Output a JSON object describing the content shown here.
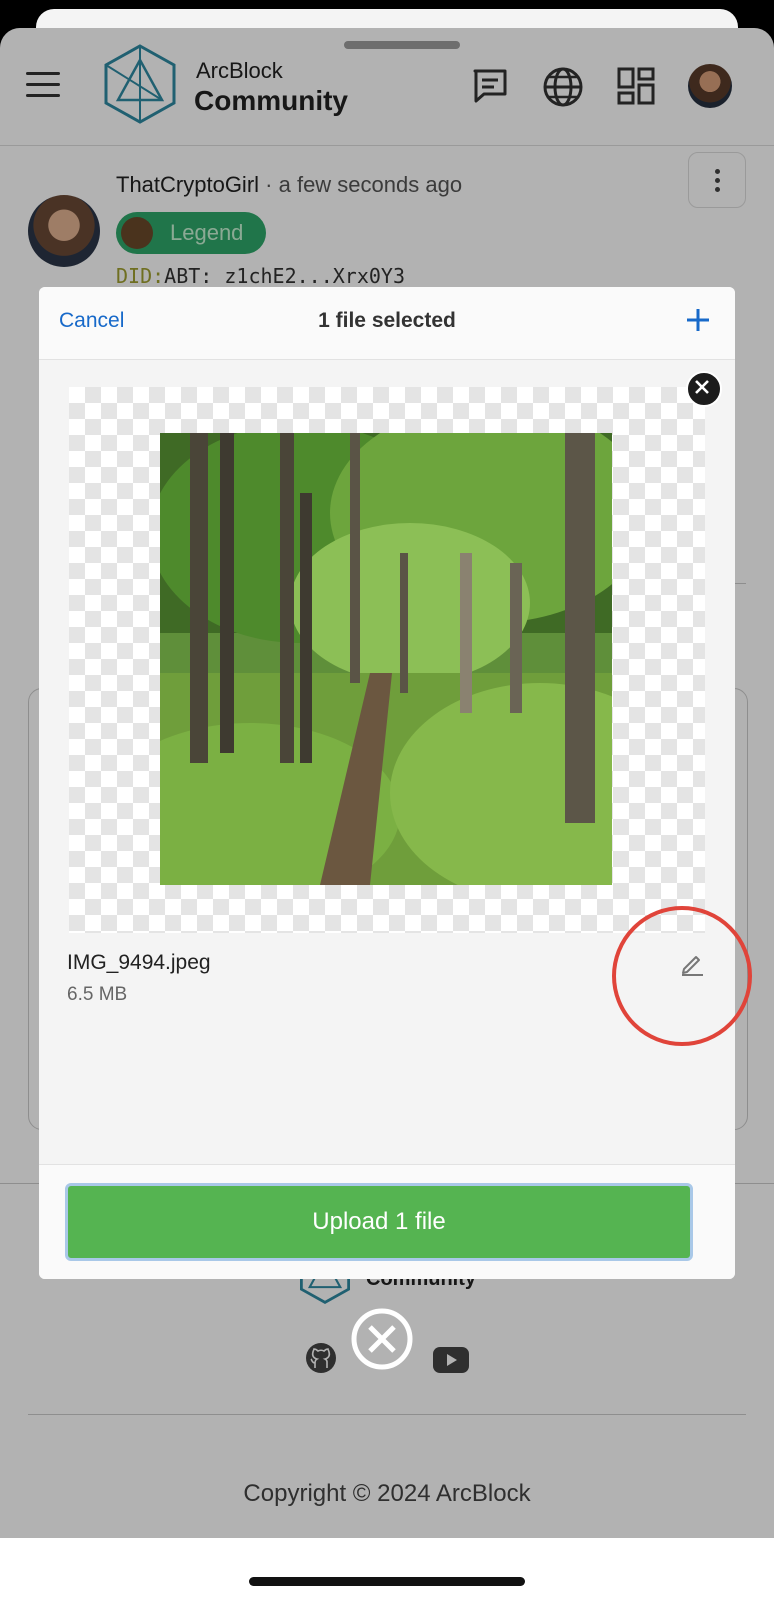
{
  "app": {
    "brand_top": "ArcBlock",
    "brand_bottom": "Community"
  },
  "post": {
    "author": "ThatCryptoGirl",
    "separator": " · ",
    "time": "a few seconds ago",
    "badge": "Legend",
    "did_prefix": "DID:",
    "did_value": "ABT:",
    "did_short": "z1chE2...Xrx0Y3"
  },
  "footer": {
    "brand": "Community",
    "copyright": "Copyright © 2024 ArcBlock"
  },
  "modal": {
    "cancel_label": "Cancel",
    "title": "1 file selected",
    "file_name": "IMG_9494.jpeg",
    "file_size": "6.5 MB",
    "upload_label": "Upload 1 file"
  },
  "colors": {
    "accent_blue": "#1769c9",
    "upload_green": "#55b451",
    "badge_green": "#2ea86a",
    "annotation_red": "#e0443a"
  },
  "icons": [
    "menu-icon",
    "chat-icon",
    "globe-icon",
    "apps-icon",
    "add-icon",
    "close-icon",
    "edit-icon",
    "github-icon",
    "youtube-icon",
    "copy-icon"
  ]
}
